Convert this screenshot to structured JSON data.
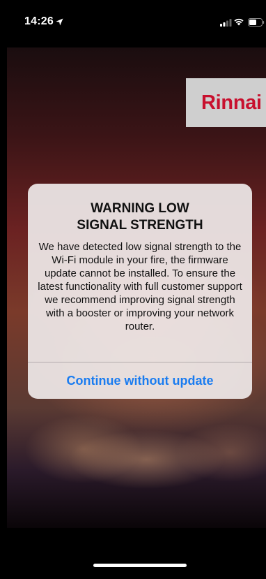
{
  "status_bar": {
    "time": "14:26",
    "icons": [
      "location-arrow-icon",
      "cellular-signal-icon",
      "wifi-icon",
      "battery-icon"
    ]
  },
  "app": {
    "logo_text": "Rinnai",
    "logo_color": "#c8102e"
  },
  "alert": {
    "title": "WARNING LOW\nSIGNAL STRENGTH",
    "message": "We have detected low signal strength to the Wi-Fi module in your fire, the firmware update cannot be installed. To ensure the latest functionality with full customer support we recommend improving signal strength with a booster or improving your network router.",
    "button_label": "Continue without update",
    "button_color": "#1a7cf0"
  }
}
